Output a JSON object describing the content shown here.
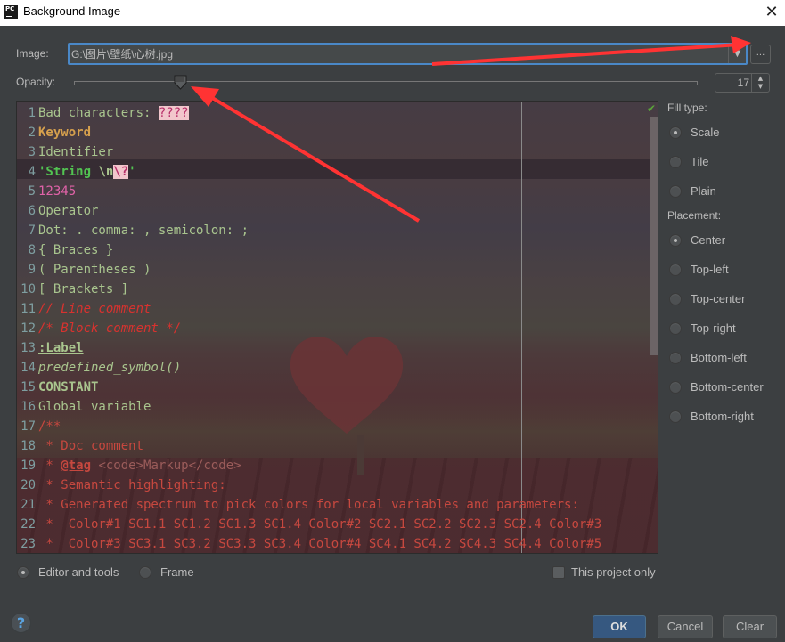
{
  "window": {
    "title": "Background Image",
    "app_icon_text": "PC",
    "close_glyph": "✕"
  },
  "image": {
    "label": "Image:",
    "value": "G:\\图片\\壁纸\\心树.jpg",
    "dropdown_glyph": "▼",
    "browse_label": "..."
  },
  "opacity": {
    "label": "Opacity:",
    "value": "17",
    "slider_percent": 17,
    "spinner_glyph": "▲▼"
  },
  "editor": {
    "status_icon": "✔",
    "lines": [
      {
        "n": "1",
        "tokens": [
          {
            "t": "Bad characters: ",
            "c": "plain"
          },
          {
            "t": "????",
            "c": "bad"
          }
        ]
      },
      {
        "n": "2",
        "tokens": [
          {
            "t": "Keyword",
            "c": "kw"
          }
        ]
      },
      {
        "n": "3",
        "tokens": [
          {
            "t": "Identifier",
            "c": "plain"
          }
        ]
      },
      {
        "n": "4",
        "tokens": [
          {
            "t": "'String ",
            "c": "str"
          },
          {
            "t": "\\n",
            "c": "esc"
          },
          {
            "t": "\\?",
            "c": "escbad"
          },
          {
            "t": "'",
            "c": "str"
          }
        ]
      },
      {
        "n": "5",
        "tokens": [
          {
            "t": "12345",
            "c": "num"
          }
        ]
      },
      {
        "n": "6",
        "tokens": [
          {
            "t": "Operator",
            "c": "plain"
          }
        ]
      },
      {
        "n": "7",
        "tokens": [
          {
            "t": "Dot: . comma: , semicolon: ;",
            "c": "plain"
          }
        ]
      },
      {
        "n": "8",
        "tokens": [
          {
            "t": "{ Braces }",
            "c": "plain"
          }
        ]
      },
      {
        "n": "9",
        "tokens": [
          {
            "t": "( Parentheses )",
            "c": "plain"
          }
        ]
      },
      {
        "n": "10",
        "tokens": [
          {
            "t": "[ Brackets ]",
            "c": "plain"
          }
        ]
      },
      {
        "n": "11",
        "tokens": [
          {
            "t": "// Line comment",
            "c": "com"
          }
        ]
      },
      {
        "n": "12",
        "tokens": [
          {
            "t": "/* Block comment */",
            "c": "com"
          }
        ]
      },
      {
        "n": "13",
        "tokens": [
          {
            "t": ":Label",
            "c": "label"
          }
        ]
      },
      {
        "n": "14",
        "tokens": [
          {
            "t": "predefined_symbol()",
            "c": "pre"
          }
        ]
      },
      {
        "n": "15",
        "tokens": [
          {
            "t": "CONSTANT",
            "c": "const"
          }
        ]
      },
      {
        "n": "16",
        "tokens": [
          {
            "t": "Global variable",
            "c": "plain"
          }
        ]
      },
      {
        "n": "17",
        "tokens": [
          {
            "t": "/**",
            "c": "doc"
          }
        ]
      },
      {
        "n": "18",
        "tokens": [
          {
            "t": " * Doc comment",
            "c": "doc"
          }
        ]
      },
      {
        "n": "19",
        "tokens": [
          {
            "t": " * ",
            "c": "doc"
          },
          {
            "t": "@tag",
            "c": "doctag"
          },
          {
            "t": " <code>Markup</code>",
            "c": "docmk"
          }
        ]
      },
      {
        "n": "20",
        "tokens": [
          {
            "t": " * Semantic highlighting:",
            "c": "doc"
          }
        ]
      },
      {
        "n": "21",
        "tokens": [
          {
            "t": " * Generated spectrum to pick colors for local variables and parameters:",
            "c": "doc"
          }
        ]
      },
      {
        "n": "22",
        "tokens": [
          {
            "t": " *  Color#1 SC1.1 SC1.2 SC1.3 SC1.4 Color#2 SC2.1 SC2.2 SC2.3 SC2.4 Color#3",
            "c": "doc"
          }
        ]
      },
      {
        "n": "23",
        "tokens": [
          {
            "t": " *  Color#3 SC3.1 SC3.2 SC3.3 SC3.4 Color#4 SC4.1 SC4.2 SC4.3 SC4.4 Color#5",
            "c": "doc"
          }
        ]
      }
    ]
  },
  "fill_type": {
    "label": "Fill type:",
    "options": [
      "Scale",
      "Tile",
      "Plain"
    ],
    "selected": "Scale"
  },
  "placement": {
    "label": "Placement:",
    "options": [
      "Center",
      "Top-left",
      "Top-center",
      "Top-right",
      "Bottom-left",
      "Bottom-center",
      "Bottom-right"
    ],
    "selected": "Center"
  },
  "target": {
    "options": [
      "Editor and tools",
      "Frame"
    ],
    "selected": "Editor and tools"
  },
  "this_project_only": {
    "label": "This project only",
    "checked": false
  },
  "footer": {
    "help_glyph": "?",
    "ok_label": "OK",
    "cancel_label": "Cancel",
    "clear_label": "Clear"
  },
  "colors": {
    "accent_focus": "#4a88c7",
    "ok_button": "#365880",
    "annotation_arrow": "#ff3333",
    "dialog_bg": "#3c3f41"
  }
}
